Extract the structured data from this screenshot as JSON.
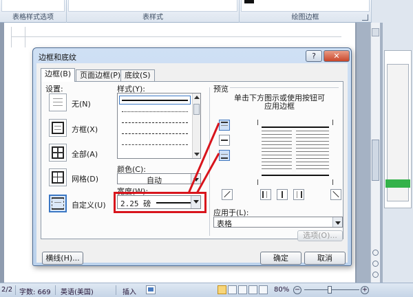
{
  "ribbon": {
    "groups": [
      {
        "label": "表格样式选项"
      },
      {
        "label": "表样式"
      },
      {
        "label": "绘图边框"
      }
    ]
  },
  "dialog": {
    "title": "边框和底纹",
    "help": "?",
    "close": "✕",
    "tabs": [
      "边框(B)",
      "页面边框(P)",
      "底纹(S)"
    ],
    "settings": {
      "label": "设置:",
      "items": [
        {
          "label": "无(N)"
        },
        {
          "label": "方框(X)"
        },
        {
          "label": "全部(A)"
        },
        {
          "label": "网格(D)"
        },
        {
          "label": "自定义(U)"
        }
      ]
    },
    "style": {
      "label": "样式(Y):"
    },
    "color": {
      "label": "颜色(C):",
      "value": "自动"
    },
    "width": {
      "label": "宽度(W):",
      "value": "2.25 磅"
    },
    "preview": {
      "label": "预览",
      "hint_line1": "单击下方图示或使用按钮可",
      "hint_line2": "应用边框"
    },
    "apply_to": {
      "label": "应用于(L):",
      "value": "表格"
    },
    "options_button": "选项(O)...",
    "hline_button": "横线(H)...",
    "ok_button": "确定",
    "cancel_button": "取消"
  },
  "status": {
    "page": "2/2",
    "words": "字数: 669",
    "language": "英语(美国)",
    "mode": "插入",
    "zoom": "80%"
  },
  "colors": {
    "annotation": "#d8141c",
    "selection": "#3a77c4"
  }
}
